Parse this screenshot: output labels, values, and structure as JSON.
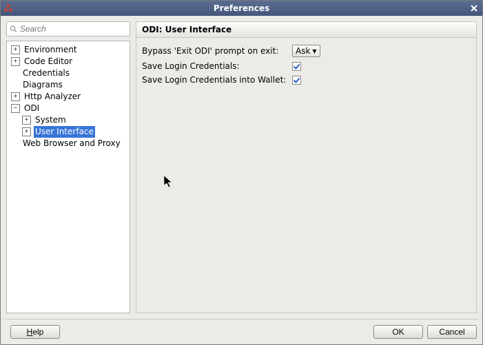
{
  "window": {
    "title": "Preferences"
  },
  "search": {
    "placeholder": "Search"
  },
  "tree": {
    "environment": "Environment",
    "code_editor": "Code Editor",
    "credentials": "Credentials",
    "diagrams": "Diagrams",
    "http_analyzer": "Http Analyzer",
    "odi": "ODI",
    "odi_system": "System",
    "odi_ui": "User Interface",
    "web_browser": "Web Browser and Proxy"
  },
  "panel": {
    "title": "ODI: User Interface",
    "bypass_label": "Bypass 'Exit ODI' prompt on exit:",
    "bypass_value": "Ask",
    "save_login_label": "Save Login Credentials:",
    "save_login_checked": true,
    "save_wallet_label": "Save Login Credentials into Wallet:",
    "save_wallet_checked": true
  },
  "buttons": {
    "help": "Help",
    "ok": "OK",
    "cancel": "Cancel"
  }
}
